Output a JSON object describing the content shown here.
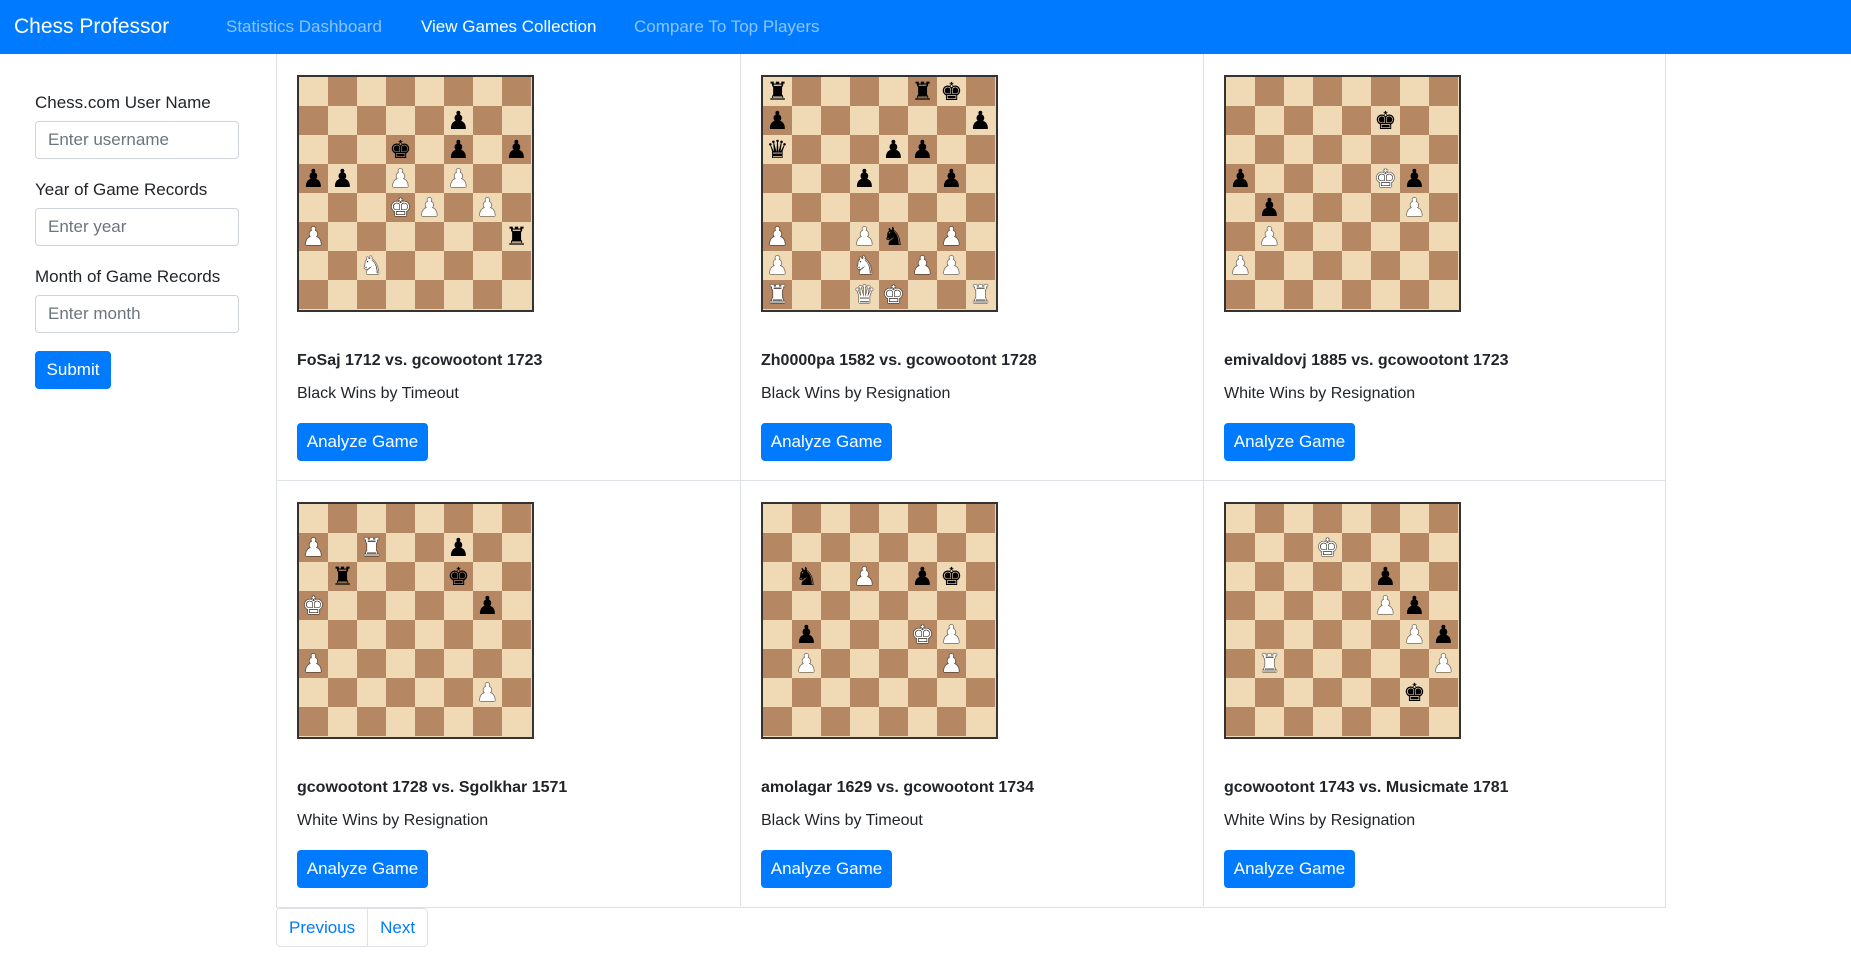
{
  "navbar": {
    "brand": "Chess Professor",
    "links": [
      {
        "label": "Statistics Dashboard",
        "active": false
      },
      {
        "label": "View Games Collection",
        "active": true
      },
      {
        "label": "Compare To Top Players",
        "active": false
      }
    ]
  },
  "sidebar": {
    "username_label": "Chess.com User Name",
    "username_placeholder": "Enter username",
    "year_label": "Year of Game Records",
    "year_placeholder": "Enter year",
    "month_label": "Month of Game Records",
    "month_placeholder": "Enter month",
    "submit_label": "Submit"
  },
  "analyze_label": "Analyze Game",
  "games": [
    {
      "title": "FoSaj 1712 vs. gcowootont 1723",
      "result": "Black Wins by Timeout",
      "board": [
        "8",
        "5p2",
        "3k1p1p",
        "pp1P1P2",
        "3KP1P1",
        "P6r",
        "2N5",
        "8"
      ]
    },
    {
      "title": "Zh0000pa 1582 vs. gcowootont 1728",
      "result": "Black Wins by Resignation",
      "board": [
        "r4rk1",
        "p6p",
        "q3pp2",
        "3p2p1",
        "8",
        "P2Pn1P1",
        "P2N1PP1",
        "R2QK2R"
      ]
    },
    {
      "title": "emivaldovj 1885 vs. gcowootont 1723",
      "result": "White Wins by Resignation",
      "board": [
        "8",
        "5k2",
        "8",
        "p4Kp1",
        "1p4P1",
        "1P6",
        "P7",
        "8"
      ]
    },
    {
      "title": "gcowootont 1728 vs. Sgolkhar 1571",
      "result": "White Wins by Resignation",
      "board": [
        "8",
        "P1R2p2",
        "1r3k2",
        "K5p1",
        "8",
        "P7",
        "6P1",
        "8"
      ]
    },
    {
      "title": "amolagar 1629 vs. gcowootont 1734",
      "result": "Black Wins by Timeout",
      "board": [
        "8",
        "8",
        "1n1P1pk1",
        "8",
        "1p3KP1",
        "1P4P1",
        "8",
        "8"
      ]
    },
    {
      "title": "gcowootont 1743 vs. Musicmate 1781",
      "result": "White Wins by Resignation",
      "board": [
        "8",
        "3K4",
        "5p2",
        "5Pp1",
        "6Pp",
        "1R5P",
        "6k1",
        "8"
      ]
    }
  ],
  "pagination": {
    "previous": "Previous",
    "next": "Next"
  }
}
